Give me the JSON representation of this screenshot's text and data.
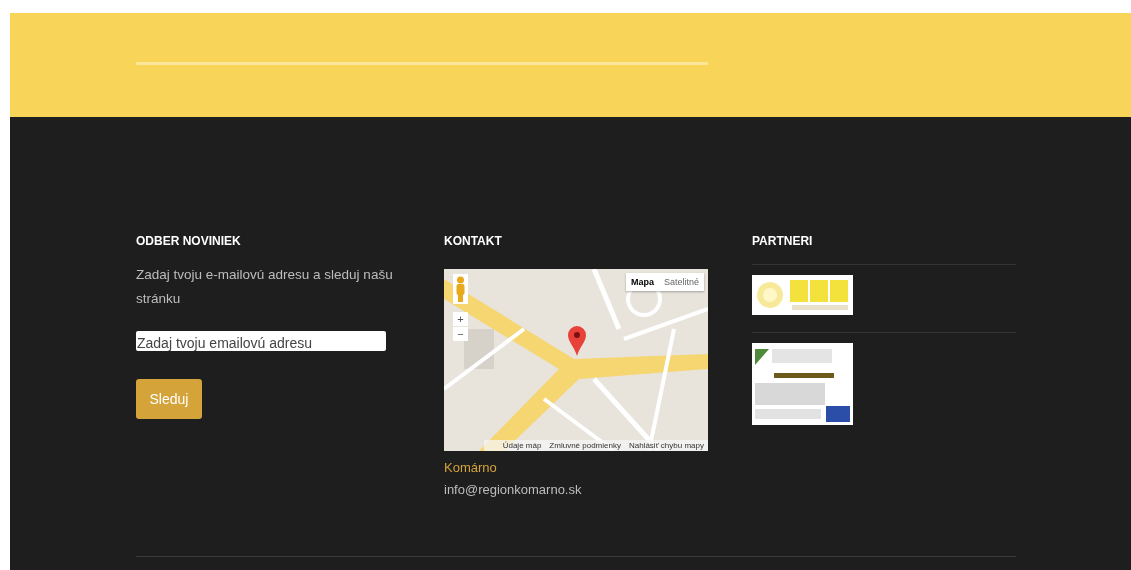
{
  "newsletter": {
    "heading": "ODBER NOVINIEK",
    "text": "Zadaj tvoju e-mailovú adresu a sleduj našu stránku",
    "email_field": {
      "placeholder": "Zadaj tvoju emailovú adresu"
    },
    "button": "Sleduj"
  },
  "contact": {
    "heading": "KONTAKT",
    "map": {
      "map_types": [
        {
          "label": "Mapa",
          "selected": true
        },
        {
          "label": "Satelitné",
          "selected": false
        }
      ],
      "zoom_in": "+",
      "zoom_out": "−",
      "footer_links": [
        "Údaje máp",
        "Zmluvné podmienky",
        "Nahlásiť chybu mapy"
      ]
    },
    "city": "Komárno",
    "email": "info@regionkomarno.sk"
  },
  "partners": {
    "heading": "PARTNERI",
    "logos": [
      {
        "kind": "sun"
      },
      {
        "kind": "project"
      }
    ]
  }
}
